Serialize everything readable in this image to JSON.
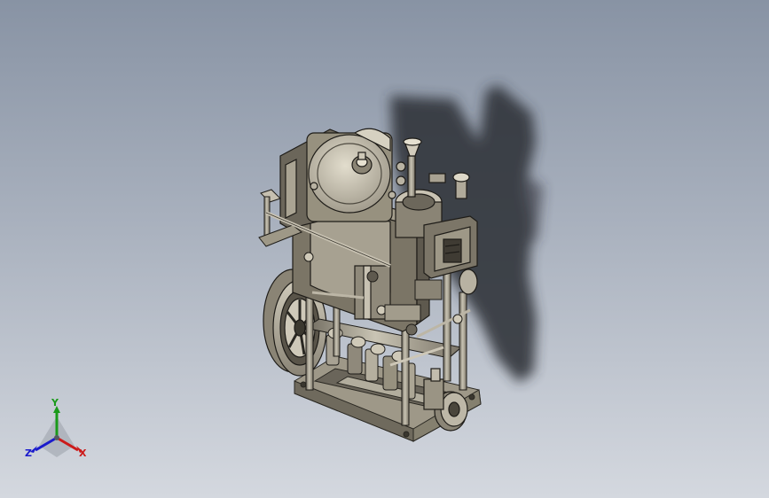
{
  "viewport": {
    "background_top": "#8893a4",
    "background_bottom": "#d4d8df",
    "model": "steam-engine-assembly"
  },
  "triad": {
    "y_label": "Y",
    "x_label": "X",
    "z_label": "Z",
    "colors": {
      "x": "#cc1a1a",
      "y": "#1a9a1a",
      "z": "#1a1acc"
    }
  }
}
